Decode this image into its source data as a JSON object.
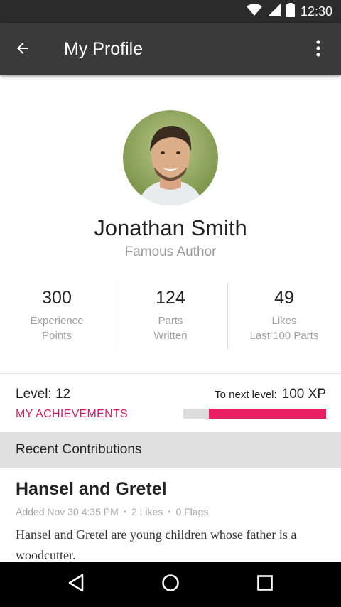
{
  "status_bar": {
    "time": "12:30",
    "icons": [
      "wifi-icon",
      "cellular-signal-icon",
      "battery-icon"
    ]
  },
  "app_bar": {
    "title": "My Profile",
    "back_icon": "arrow-left-icon",
    "menu_icon": "more-vertical-icon"
  },
  "profile": {
    "name": "Jonathan Smith",
    "role": "Famous Author",
    "avatar": "profile-photo"
  },
  "stats": [
    {
      "value": "300",
      "label_line1": "Experience",
      "label_line2": "Points"
    },
    {
      "value": "124",
      "label_line1": "Parts",
      "label_line2": "Written"
    },
    {
      "value": "49",
      "label_line1": "Likes",
      "label_line2": "Last 100 Parts"
    }
  ],
  "level": {
    "label": "Level: 12",
    "achievements_link": "MY ACHIEVEMENTS",
    "next_level_label": "To next level:",
    "next_level_value": "100 XP",
    "progress_fraction": 0.82
  },
  "recent": {
    "header": "Recent Contributions",
    "items": [
      {
        "title": "Hansel and Gretel",
        "added": "Added Nov 30 4:35 PM",
        "likes": "2 Likes",
        "flags": "0 Flags",
        "excerpt": "Hansel and Gretel are young children whose father is a woodcutter."
      }
    ]
  },
  "nav_bar": {
    "icons": [
      "back-triangle-icon",
      "home-circle-icon",
      "recents-square-icon"
    ]
  },
  "colors": {
    "accent": "#e91e63",
    "accent_text": "#d81b60",
    "app_bar": "#3a3a3a",
    "status_bar": "#2b2b2b"
  }
}
